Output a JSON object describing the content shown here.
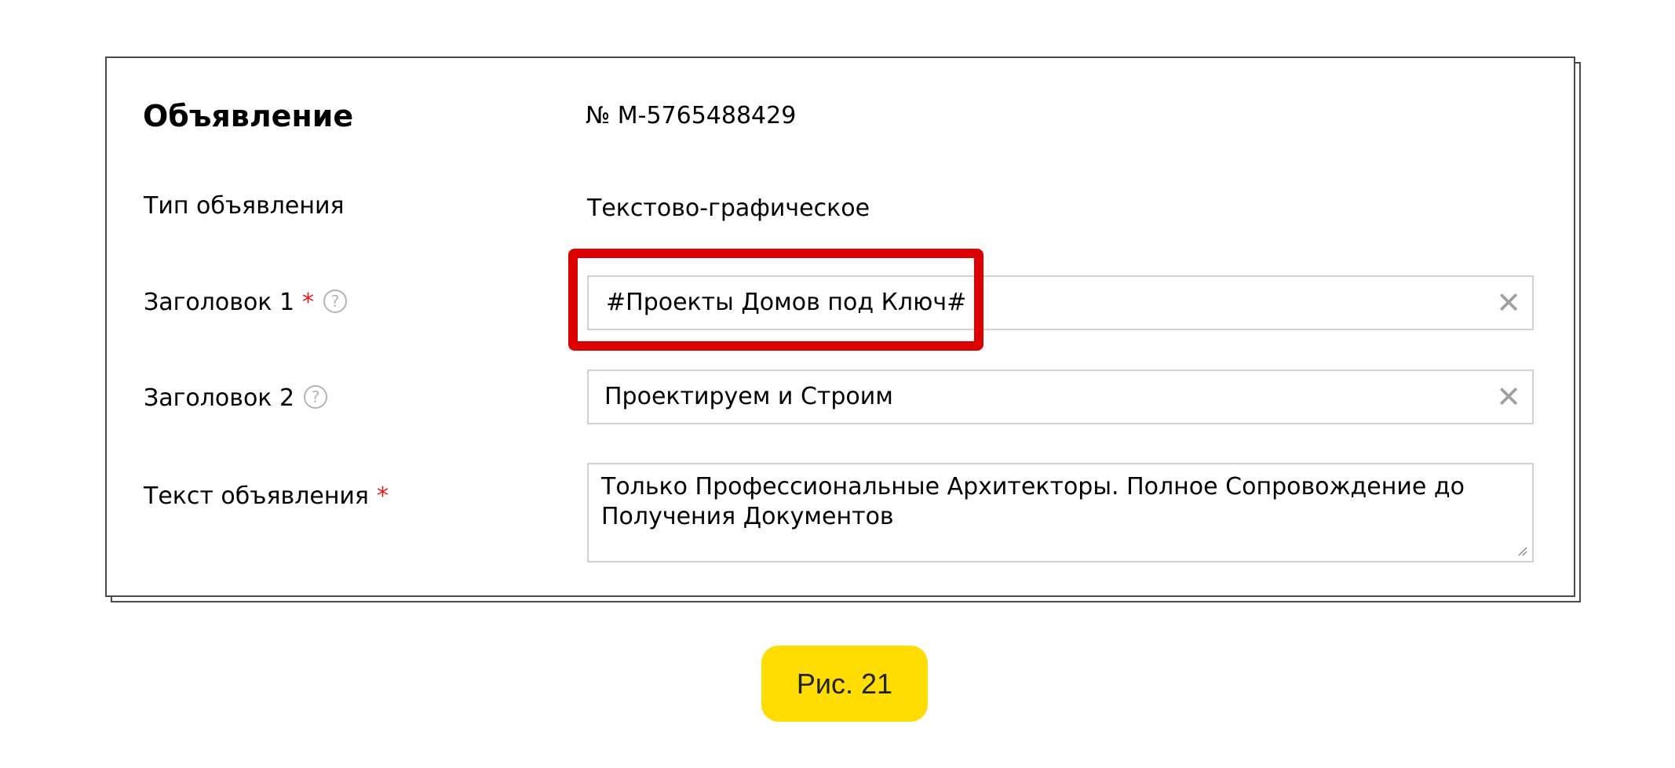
{
  "ad": {
    "title": "Объявление",
    "number": "№ M-5765488429"
  },
  "rows": {
    "type": {
      "label": "Тип объявления",
      "value": "Текстово-графическое"
    },
    "headline1": {
      "label": "Заголовок 1",
      "required": "*",
      "value": "#Проекты Домов под Ключ#"
    },
    "headline2": {
      "label": "Заголовок 2",
      "value": "Проектируем и Строим"
    },
    "text": {
      "label": "Текст объявления",
      "required": "*",
      "value": "Только Профессиональные Архитекторы. Полное Сопровождение до Получения Документов"
    }
  },
  "icons": {
    "help": "question-circle-icon",
    "clear": "close-icon",
    "resize": "resize-grip-icon",
    "help_glyph": "?",
    "clear_glyph": "✕"
  },
  "caption": "Рис. 21",
  "colors": {
    "highlight": "#dd0000",
    "badge": "#ffdd00",
    "required": "#e31b1b"
  }
}
